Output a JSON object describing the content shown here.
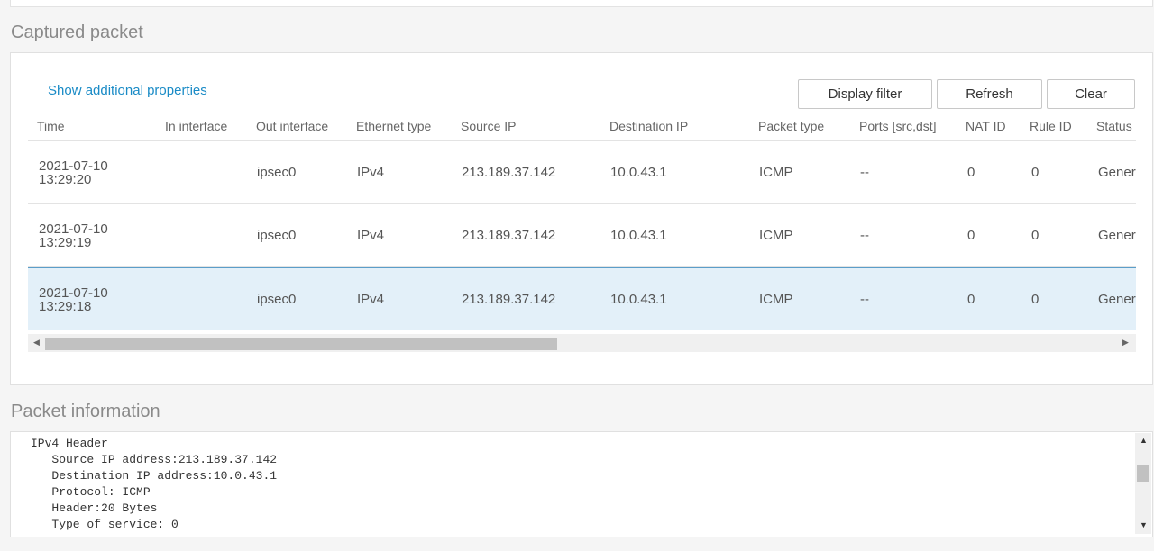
{
  "captured": {
    "title": "Captured packet",
    "show_props_link": "Show additional properties",
    "buttons": {
      "display_filter": "Display filter",
      "refresh": "Refresh",
      "clear": "Clear"
    },
    "columns": [
      "Time",
      "In interface",
      "Out interface",
      "Ethernet type",
      "Source IP",
      "Destination IP",
      "Packet type",
      "Ports [src,dst]",
      "NAT ID",
      "Rule ID",
      "Status"
    ],
    "rows": [
      {
        "date": "2021-07-10",
        "clock": "13:29:20",
        "in_iface": "",
        "out_iface": "ipsec0",
        "eth_type": "IPv4",
        "src_ip": "213.189.37.142",
        "dst_ip": "10.0.43.1",
        "pkt_type": "ICMP",
        "ports": "--",
        "nat_id": "0",
        "rule_id": "0",
        "status": "Genera"
      },
      {
        "date": "2021-07-10",
        "clock": "13:29:19",
        "in_iface": "",
        "out_iface": "ipsec0",
        "eth_type": "IPv4",
        "src_ip": "213.189.37.142",
        "dst_ip": "10.0.43.1",
        "pkt_type": "ICMP",
        "ports": "--",
        "nat_id": "0",
        "rule_id": "0",
        "status": "Genera"
      },
      {
        "date": "2021-07-10",
        "clock": "13:29:18",
        "in_iface": "",
        "out_iface": "ipsec0",
        "eth_type": "IPv4",
        "src_ip": "213.189.37.142",
        "dst_ip": "10.0.43.1",
        "pkt_type": "ICMP",
        "ports": "--",
        "nat_id": "0",
        "rule_id": "0",
        "status": "Genera"
      }
    ],
    "selected_row": 2
  },
  "info": {
    "title": "Packet information",
    "lines": [
      "IPv4 Header",
      "   Source IP address:213.189.37.142",
      "   Destination IP address:10.0.43.1",
      "   Protocol: ICMP",
      "   Header:20 Bytes",
      "   Type of service: 0"
    ]
  },
  "icons": {
    "scroll_left": "triangle-left-icon",
    "scroll_right": "triangle-right-icon",
    "scroll_up": "triangle-up-icon",
    "scroll_down": "triangle-down-icon"
  },
  "colors": {
    "link": "#1a8bc6",
    "selected_row_bg": "#e3f0f9",
    "selected_row_border": "#5b9ec9"
  }
}
